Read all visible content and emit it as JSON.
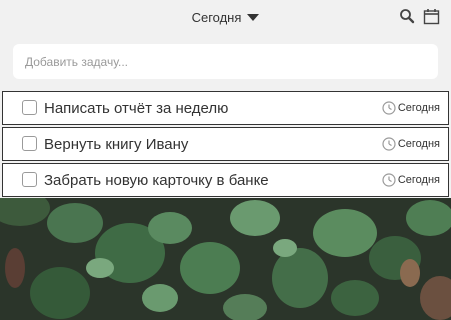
{
  "header": {
    "filter_label": "Сегодня",
    "search_icon": "search-icon",
    "calendar_icon": "calendar-icon"
  },
  "add_task": {
    "placeholder": "Добавить задачу..."
  },
  "tasks": [
    {
      "title": "Написать отчёт за неделю",
      "due": "Сегодня",
      "checked": false
    },
    {
      "title": "Вернуть книгу Ивану",
      "due": "Сегодня",
      "checked": false
    },
    {
      "title": "Забрать новую карточку в банке",
      "due": "Сегодня",
      "checked": false
    }
  ],
  "colors": {
    "background": "#f1f1f1",
    "task_border": "#333333",
    "text": "#333333",
    "photo_leaf": "#3f6b45"
  }
}
